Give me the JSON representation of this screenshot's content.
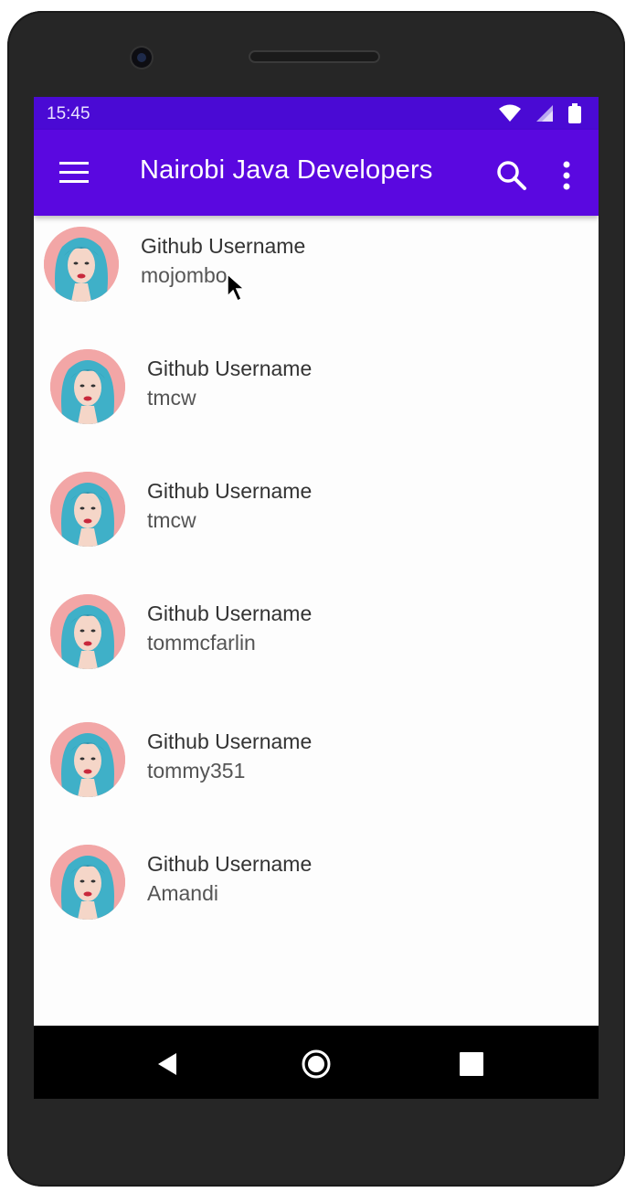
{
  "status_bar": {
    "time": "15:45",
    "icons": [
      "wifi-icon",
      "cell-signal-icon",
      "battery-icon"
    ]
  },
  "app_bar": {
    "title": "Nairobi Java Developers",
    "menu_icon": "hamburger-menu-icon",
    "search_icon": "search-icon",
    "overflow_icon": "more-vert-icon"
  },
  "developers": [
    {
      "label": "Github Username",
      "username": "mojombo"
    },
    {
      "label": "Github Username",
      "username": "tmcw"
    },
    {
      "label": "Github Username",
      "username": "tmcw"
    },
    {
      "label": "Github Username",
      "username": "tommcfarlin"
    },
    {
      "label": "Github Username",
      "username": "tommy351"
    },
    {
      "label": "Github Username",
      "username": "Amandi"
    }
  ],
  "nav_bar": {
    "back_icon": "back-triangle-icon",
    "home_icon": "home-circle-icon",
    "recents_icon": "recents-square-icon"
  },
  "colors": {
    "status_bar": "#4a0ad4",
    "app_bar": "#5a08e0",
    "avatar_background": "#f2a6a6",
    "hair": "#3fb0c8"
  }
}
